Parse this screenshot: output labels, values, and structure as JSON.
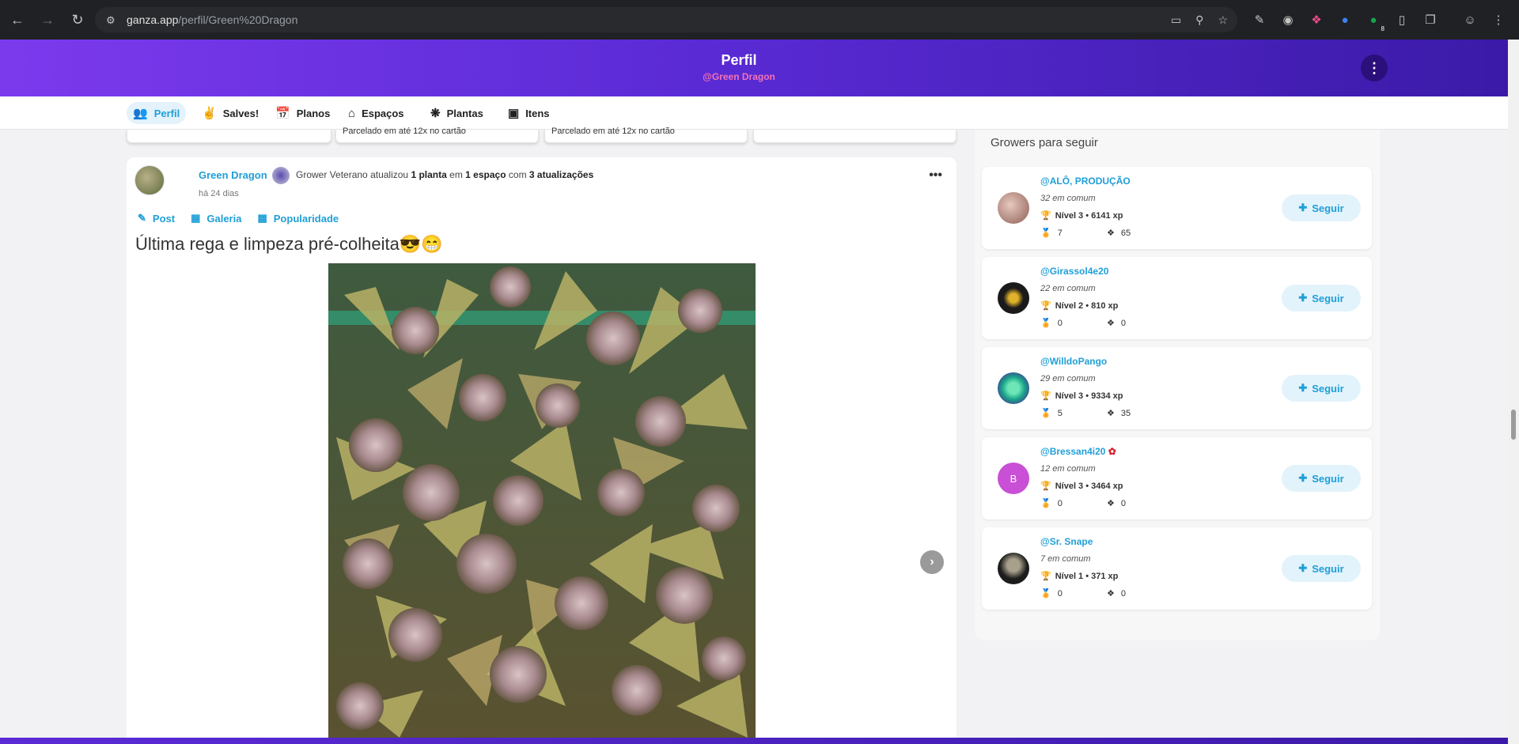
{
  "browser": {
    "url_host": "ganza.app",
    "url_path": "/perfil/Green%20Dragon",
    "ext_badge": "8"
  },
  "header": {
    "title": "Perfil",
    "subtitle": "@Green Dragon"
  },
  "tabs": [
    {
      "label": "Perfil",
      "icon": "people-icon",
      "active": true
    },
    {
      "label": "Salves!",
      "icon": "peace-hand-icon",
      "active": false
    },
    {
      "label": "Planos",
      "icon": "calendar-icon",
      "active": false
    },
    {
      "label": "Espaços",
      "icon": "home-icon",
      "active": false
    },
    {
      "label": "Plantas",
      "icon": "leaf-icon",
      "active": false
    },
    {
      "label": "Itens",
      "icon": "toolbox-icon",
      "active": false
    }
  ],
  "prev_cards": [
    {
      "text": "Parcelado em até 12x no cartão"
    },
    {
      "text": "Parcelado em até 12x no cartão"
    }
  ],
  "post": {
    "author": "Green Dragon",
    "role": "Grower Veterano",
    "activity_pre": "atualizou",
    "plants": "1 planta",
    "in": "em",
    "spaces": "1 espaço",
    "with": "com",
    "updates": "3 atualizações",
    "time": "há 24 dias",
    "tabs": [
      "Post",
      "Galeria",
      "Popularidade"
    ],
    "caption": "Última rega e limpeza pré-colheita😎😁"
  },
  "sidebar": {
    "heading": "Growers para seguir",
    "follow_label": "Seguir",
    "growers": [
      {
        "name": "@ALÔ, PRODUÇÃO",
        "common": "32 em comum",
        "level": "Nível 3 • 6141 xp",
        "badges": "7",
        "plants": "65",
        "avatar_color": "#c9a39a"
      },
      {
        "name": "@Girassol4e20",
        "common": "22 em comum",
        "level": "Nível 2 • 810 xp",
        "badges": "0",
        "plants": "0",
        "avatar_color": "#1a1a1a"
      },
      {
        "name": "@WilldoPango",
        "common": "29 em comum",
        "level": "Nível 3 • 9334 xp",
        "badges": "5",
        "plants": "35",
        "avatar_color": "#1aa58a"
      },
      {
        "name": "@Bressan4i20",
        "common": "12 em comum",
        "level": "Nível 3 • 3464 xp",
        "badges": "0",
        "plants": "0",
        "avatar_color": "#c94fd6",
        "initial": "B"
      },
      {
        "name": "@Sr. Snape",
        "common": "7 em comum",
        "level": "Nível 1 • 371 xp",
        "badges": "0",
        "plants": "0",
        "avatar_color": "#2c2c2c"
      }
    ]
  },
  "colors": {
    "accent": "#1f9fd8",
    "header_start": "#7c3aed",
    "header_end": "#3b1aa8",
    "subtitle_pink": "#f472b6"
  }
}
